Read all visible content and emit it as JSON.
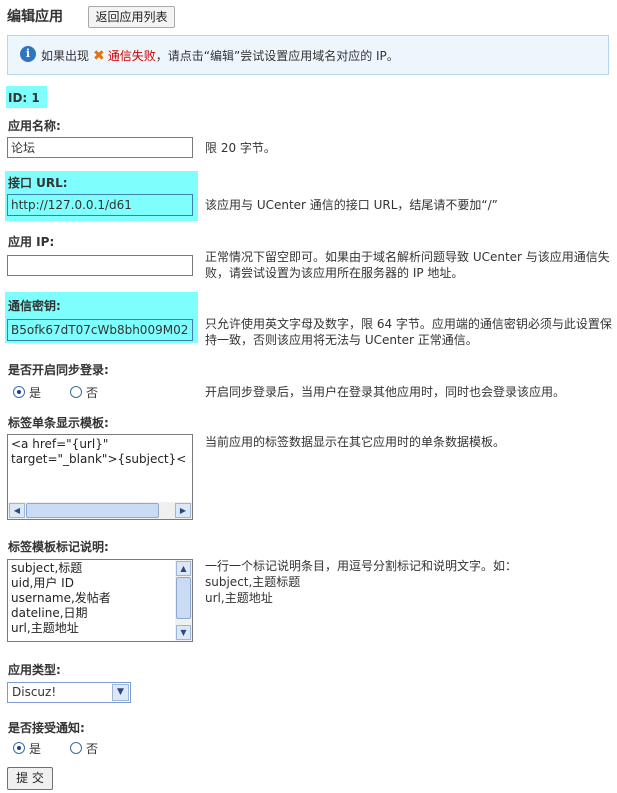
{
  "page": {
    "title": "编辑应用",
    "back_button": "返回应用列表"
  },
  "notice": {
    "icon": "info-icon",
    "prefix": "如果出现",
    "error": "通信失败",
    "suffix": "，请点击“编辑”尝试设置应用域名对应的 IP。"
  },
  "id_label": "ID: 1",
  "form": {
    "app_name": {
      "label": "应用名称:",
      "value": "论坛",
      "hint": "限 20 字节。"
    },
    "api_url": {
      "label": "接口 URL:",
      "value": "http://127.0.0.1/d61",
      "hint": "该应用与 UCenter 通信的接口 URL，结尾请不要加“/”"
    },
    "app_ip": {
      "label": "应用 IP:",
      "value": "",
      "hint": "正常情况下留空即可。如果由于域名解析问题导致 UCenter 与该应用通信失败，请尝试设置为该应用所在服务器的 IP 地址。"
    },
    "comm_key": {
      "label": "通信密钥:",
      "value": "B5ofk67dT07cWb8bh009M02",
      "hint": "只允许使用英文字母及数字，限 64 字节。应用端的通信密钥必须与此设置保持一致，否则该应用将无法与 UCenter 正常通信。"
    },
    "sync_login": {
      "label": "是否开启同步登录:",
      "yes": "是",
      "no": "否",
      "selected": "yes",
      "hint": "开启同步登录后，当用户在登录其他应用时，同时也会登录该应用。"
    },
    "tag_template": {
      "label": "标签单条显示模板:",
      "value": "<a href=\"{url}\"\ntarget=\"_blank\">{subject}<",
      "hint": "当前应用的标签数据显示在其它应用时的单条数据模板。"
    },
    "tag_fields": {
      "label": "标签模板标记说明:",
      "value": "subject,标题\nuid,用户 ID\nusername,发帖者\ndateline,日期\nurl,主题地址",
      "hint": "一行一个标记说明条目，用逗号分割标记和说明文字。如：\nsubject,主题标题\nurl,主题地址"
    },
    "app_type": {
      "label": "应用类型:",
      "value": "Discuz!"
    },
    "accept_notify": {
      "label": "是否接受通知:",
      "yes": "是",
      "no": "否",
      "selected": "yes"
    },
    "submit": "提 交"
  }
}
